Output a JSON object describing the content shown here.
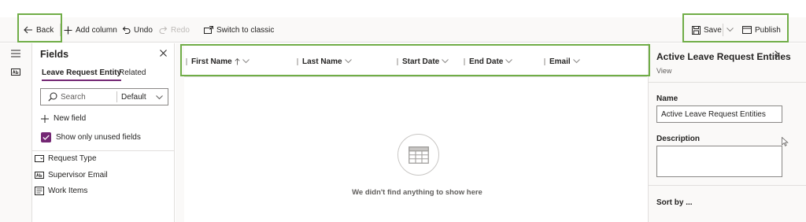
{
  "toolbar": {
    "back_label": "Back",
    "add_column_label": "Add column",
    "undo_label": "Undo",
    "redo_label": "Redo",
    "switch_classic_label": "Switch to classic",
    "save_label": "Save",
    "publish_label": "Publish"
  },
  "rail": {
    "items": [
      {
        "icon": "hamburger-icon"
      },
      {
        "icon": "text-field-icon"
      }
    ]
  },
  "fields_pane": {
    "title": "Fields",
    "tabs": [
      {
        "label": "Leave Request Entity",
        "active": true
      },
      {
        "label": "Related",
        "active": false
      }
    ],
    "search_placeholder": "Search",
    "filter_value": "Default",
    "new_field_label": "New field",
    "show_unused_label": "Show only unused fields",
    "show_unused_checked": true,
    "items": [
      {
        "label": "Request Type",
        "icon": "option-set-icon"
      },
      {
        "label": "Supervisor Email",
        "icon": "text-field-icon"
      },
      {
        "label": "Work Items",
        "icon": "multiline-text-icon"
      }
    ]
  },
  "grid": {
    "columns": [
      {
        "label": "First Name",
        "sorted": "ascending"
      },
      {
        "label": "Last Name"
      },
      {
        "label": "Start Date"
      },
      {
        "label": "End Date"
      },
      {
        "label": "Email"
      }
    ],
    "empty_message": "We didn't find anything to show here"
  },
  "properties": {
    "title": "Active Leave Request Entities",
    "subtitle": "View",
    "name_label": "Name",
    "name_value": "Active Leave Request Entities",
    "description_label": "Description",
    "description_value": "",
    "sort_label": "Sort by ..."
  },
  "colors": {
    "accent": "#742774",
    "highlight": "#70ad47"
  }
}
